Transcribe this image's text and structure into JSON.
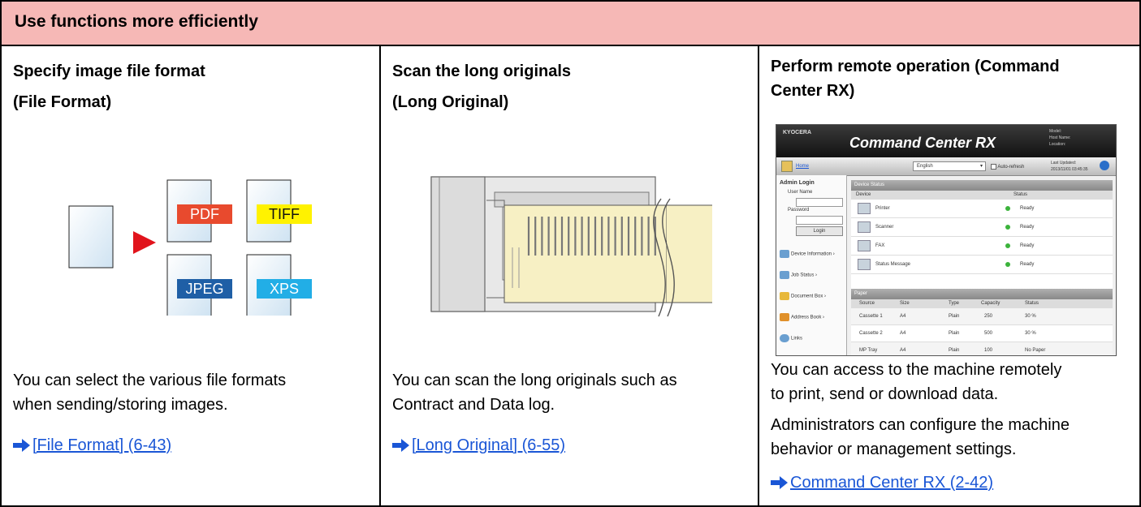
{
  "header": {
    "title": "Use functions more efficiently"
  },
  "columns": [
    {
      "title_lines": [
        "Specify image file format",
        "(File Format)"
      ],
      "formats": [
        "PDF",
        "TIFF",
        "JPEG",
        "XPS"
      ],
      "format_colors": {
        "PDF": "#e84a2e",
        "TIFF": "#fff200",
        "JPEG": "#1f5fa6",
        "XPS": "#22aee6"
      },
      "description_lines": [
        "You can select the various file formats",
        "when sending/storing images."
      ],
      "link": "[File Format] (6-43)"
    },
    {
      "title_lines": [
        "Scan the long originals",
        "(Long Original)"
      ],
      "description_lines": [
        "You can scan the long originals such as",
        "Contract and Data log."
      ],
      "link": "[Long Original] (6-55)"
    },
    {
      "title_lines": [
        "Perform remote operation (Command",
        "Center RX)"
      ],
      "description_lines": [
        "You can access to the machine remotely",
        "to print, send or download data."
      ],
      "description2_lines": [
        "Administrators can configure the machine",
        "behavior or management settings."
      ],
      "link": "Command Center RX (2-42)"
    }
  ],
  "command_center": {
    "brand": "KYOCERA",
    "title": "Command Center RX",
    "info": [
      "Model:",
      "Host Name:",
      "Location:"
    ],
    "home": "Home",
    "language": "English",
    "auto_refresh": "Auto-refresh",
    "last_updated": [
      "Last Updated:",
      "2013/11/01 03:45:35"
    ],
    "login_title": "Admin Login",
    "user_name": "User Name",
    "password": "Password",
    "login_button": "Login",
    "side_items": [
      "Device Information",
      "Job Status",
      "Document Box",
      "Address Book",
      "Links"
    ],
    "device_status_header": "Device Status",
    "device_col": "Device",
    "status_col": "Status",
    "devices": [
      {
        "name": "Printer",
        "status": "Ready"
      },
      {
        "name": "Scanner",
        "status": "Ready"
      },
      {
        "name": "FAX",
        "status": "Ready"
      },
      {
        "name": "Status Message",
        "status": "Ready"
      }
    ],
    "paper_header": "Paper",
    "paper_cols": [
      "Source",
      "Size",
      "Type",
      "Capacity",
      "Status"
    ],
    "paper_rows": [
      [
        "Cassette 1",
        "A4",
        "Plain",
        "250",
        "30 %"
      ],
      [
        "Cassette 2",
        "A4",
        "Plain",
        "500",
        "30 %"
      ],
      [
        "MP Tray",
        "A4",
        "Plain",
        "100",
        "No Paper"
      ]
    ]
  }
}
